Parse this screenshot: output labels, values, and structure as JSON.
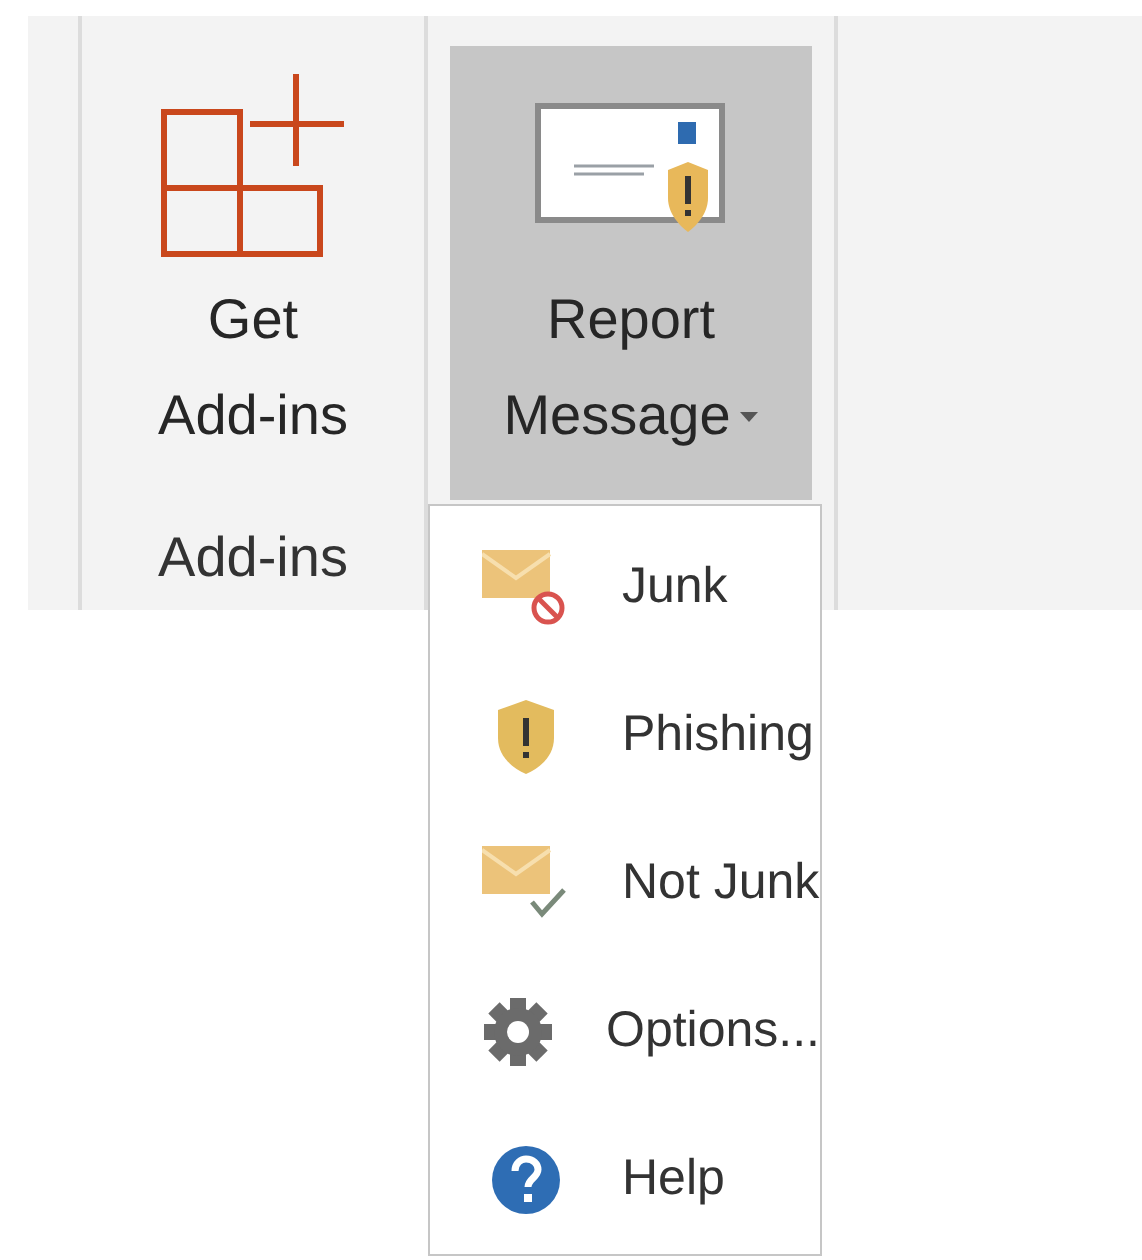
{
  "ribbon": {
    "groups": [
      {
        "label": "Add-ins",
        "buttons": [
          {
            "label_lines": [
              "Get",
              "Add-ins"
            ],
            "pressed": false,
            "dropdown": false
          }
        ]
      },
      {
        "buttons": [
          {
            "label_lines": [
              "Report",
              "Message"
            ],
            "pressed": true,
            "dropdown": true
          }
        ]
      }
    ]
  },
  "menu": {
    "items": [
      {
        "kind": "junk",
        "label": "Junk"
      },
      {
        "kind": "phishing",
        "label": "Phishing"
      },
      {
        "kind": "not_junk",
        "label": "Not Junk"
      },
      {
        "kind": "options",
        "label": "Options..."
      },
      {
        "kind": "help",
        "label": "Help"
      }
    ]
  }
}
